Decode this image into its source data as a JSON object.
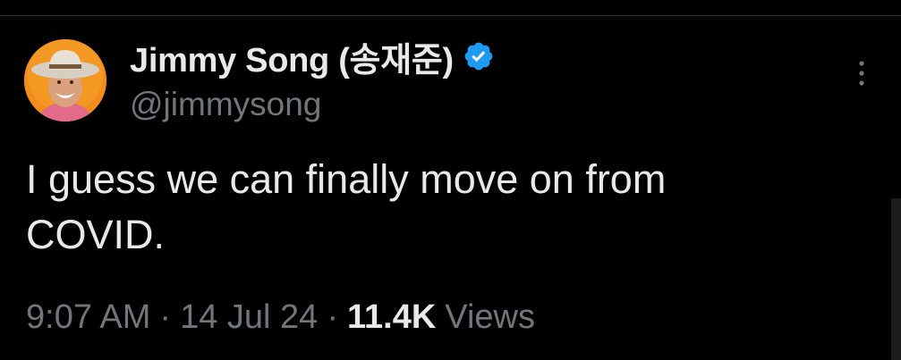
{
  "author": {
    "display_name": "Jimmy Song (송재준)",
    "handle": "@jimmysong",
    "avatar_icon": "avatar-cowboy-hat-icon",
    "verified_icon": "verified-badge-icon"
  },
  "menu": {
    "more_icon": "more-vertical-icon"
  },
  "tweet": {
    "text": "I guess we can finally move on from\nCOVID."
  },
  "meta": {
    "time": "9:07 AM",
    "separator": "·",
    "date": "14 Jul 24",
    "views_count": "11.4K",
    "views_label": "Views"
  },
  "colors": {
    "background": "#000000",
    "primary_text": "#e7e9ea",
    "secondary_text": "#71767b",
    "verified_blue": "#1d9bf0",
    "divider": "#2f3336"
  }
}
